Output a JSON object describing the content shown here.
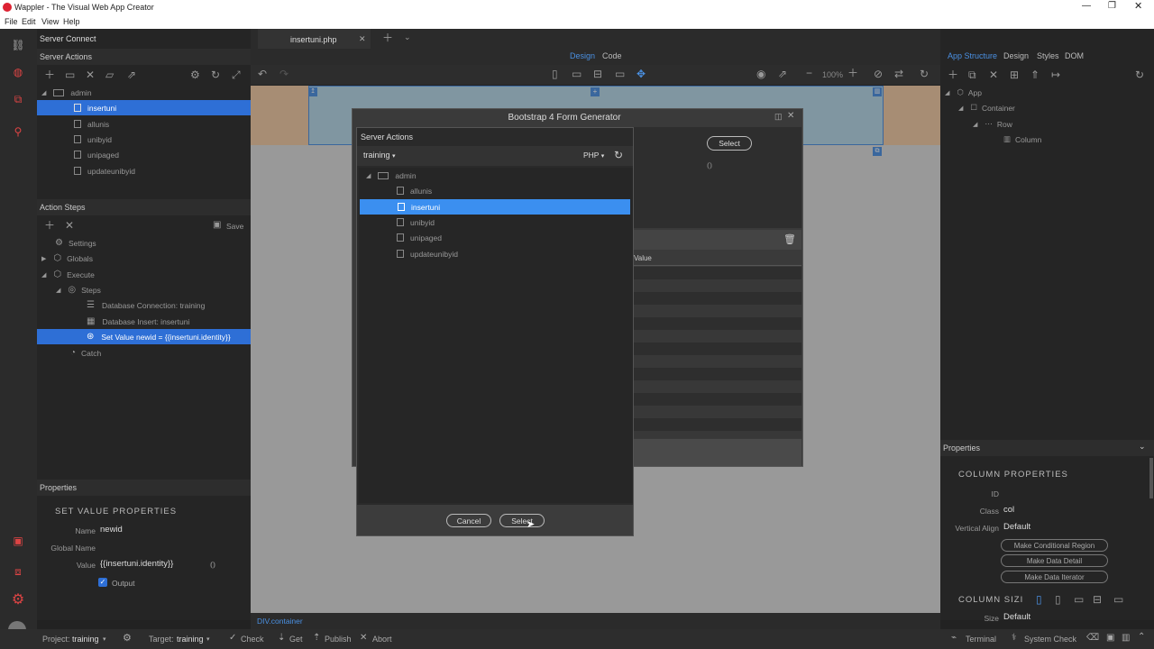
{
  "window": {
    "title": "Wappler - The Visual Web App Creator"
  },
  "menu": [
    "File",
    "Edit",
    "View",
    "Help"
  ],
  "left": {
    "server_connect": "Server Connect",
    "server_actions": "Server Actions",
    "tree": {
      "folder": "admin",
      "files": [
        "insertuni",
        "allunis",
        "unibyid",
        "unipaged",
        "updateunibyid"
      ]
    },
    "action_steps": "Action Steps",
    "save": "Save",
    "steps": [
      "Settings",
      "Globals",
      "Execute",
      "Steps",
      "Database Connection: training",
      "Database Insert: insertuni",
      "Set Value newid = {{insertuni.identity}}",
      "Catch"
    ],
    "properties": "Properties",
    "set_value_props": "SET VALUE PROPERTIES",
    "name_label": "Name",
    "name_value": "newid",
    "global_name_label": "Global Name",
    "value_label": "Value",
    "value_value": "{{insertuni.identity}}",
    "output_label": "Output"
  },
  "center": {
    "tab": "insertuni.php",
    "design": "Design",
    "code": "Code",
    "zoom": "100%",
    "breadcrumb": "DIV.container"
  },
  "generator": {
    "title": "Bootstrap 4 Form Generator",
    "select": "Select",
    "value_col": "Value"
  },
  "server_actions_dialog": {
    "title": "Server Actions",
    "connection": "training",
    "lang": "PHP",
    "folder": "admin",
    "files": [
      "allunis",
      "insertuni",
      "unibyid",
      "unipaged",
      "updateunibyid"
    ],
    "cancel": "Cancel",
    "select": "Select"
  },
  "right": {
    "tabs": [
      "App Structure",
      "Design",
      "Styles",
      "DOM"
    ],
    "tree": [
      "App",
      "Container",
      "Row",
      "Column"
    ],
    "properties": "Properties",
    "column_props": "COLUMN PROPERTIES",
    "id_label": "ID",
    "class_label": "Class",
    "class_value": "col",
    "valign_label": "Vertical Align",
    "valign_value": "Default",
    "buttons": [
      "Make Conditional Region",
      "Make Data Detail",
      "Make Data Iterator"
    ],
    "column_sizing": "COLUMN SIZI",
    "size_label": "Size",
    "size_value": "Default"
  },
  "status": {
    "project_label": "Project:",
    "project": "training",
    "target_label": "Target:",
    "target": "training",
    "check": "Check",
    "get": "Get",
    "publish": "Publish",
    "abort": "Abort",
    "terminal": "Terminal",
    "system_check": "System Check"
  },
  "colors": {
    "selection": "#2e6fd6",
    "accent": "#4a90e2"
  }
}
